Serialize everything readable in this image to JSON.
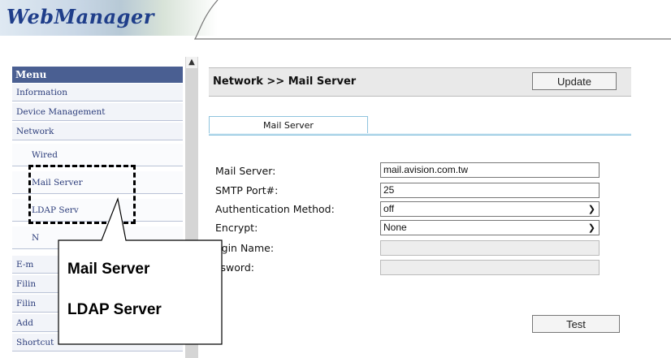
{
  "header": {
    "logo_text": "WebManager"
  },
  "sidebar": {
    "title": "Menu",
    "items": [
      {
        "label": "Information"
      },
      {
        "label": "Device Management"
      },
      {
        "label": "Network"
      },
      {
        "label": "Wired"
      },
      {
        "label": "Mail Server"
      },
      {
        "label": "LDAP Serv"
      },
      {
        "label": "N"
      },
      {
        "label": "E-m"
      },
      {
        "label": "Filin"
      },
      {
        "label": "Filin"
      },
      {
        "label": "Add"
      },
      {
        "label": "Shortcut"
      }
    ]
  },
  "main": {
    "title": "Network >> Mail Server",
    "update_label": "Update",
    "tab_label": "Mail Server",
    "fields": [
      {
        "label": "Mail Server:",
        "value": "mail.avision.com.tw"
      },
      {
        "label": "SMTP Port#:",
        "value": "25"
      },
      {
        "label": "Authentication Method:",
        "value": "off"
      },
      {
        "label": "Encrypt:",
        "value": "None"
      },
      {
        "label": "ogin Name:",
        "value": ""
      },
      {
        "label": "ssword:",
        "value": ""
      }
    ],
    "test_label": "Test"
  },
  "callout": {
    "line1": "Mail Server",
    "line2": "LDAP Server"
  },
  "colors": {
    "menu_header": "#4a5f92",
    "tab_border": "#8fc4de",
    "logo": "#1f3e8a"
  }
}
